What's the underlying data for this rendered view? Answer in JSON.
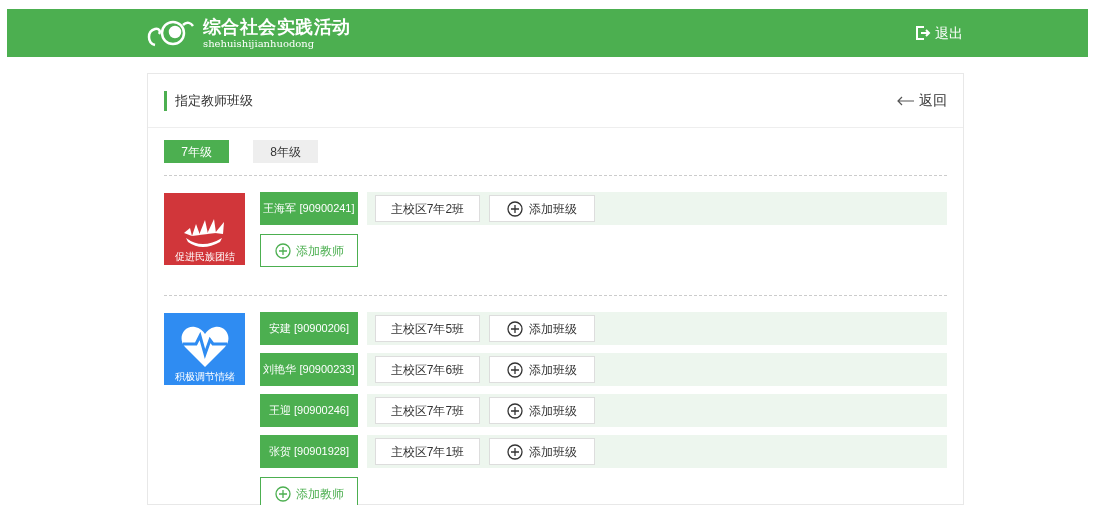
{
  "header": {
    "logo_title": "综合社会实践活动",
    "logo_subtitle": "shehuishijianhuodong",
    "logout": "退出"
  },
  "page": {
    "title": "指定教师班级",
    "back": "返回"
  },
  "grade_tabs": [
    {
      "label": "7年级",
      "selected": true
    },
    {
      "label": "8年级",
      "selected": false
    }
  ],
  "groups": [
    {
      "name": "促进民族团结",
      "kind": "fan",
      "color": "#d1363a",
      "teachers": [
        {
          "name": "王海军",
          "id": "[90900241]",
          "classes": [
            "主校区7年2班"
          ],
          "add_class": "添加班级"
        }
      ],
      "add_teacher": "添加教师"
    },
    {
      "name": "积极调节情绪",
      "kind": "heart",
      "color": "#2f8cf2",
      "teachers": [
        {
          "name": "安建",
          "id": "[90900206]",
          "classes": [
            "主校区7年5班"
          ],
          "add_class": "添加班级"
        },
        {
          "name": "刘艳华",
          "id": "[90900233]",
          "classes": [
            "主校区7年6班"
          ],
          "add_class": "添加班级"
        },
        {
          "name": "王迎",
          "id": "[90900246]",
          "classes": [
            "主校区7年7班"
          ],
          "add_class": "添加班级"
        },
        {
          "name": "张贺",
          "id": "[90901928]",
          "classes": [
            "主校区7年1班"
          ],
          "add_class": "添加班级"
        }
      ],
      "add_teacher": "添加教师"
    }
  ]
}
